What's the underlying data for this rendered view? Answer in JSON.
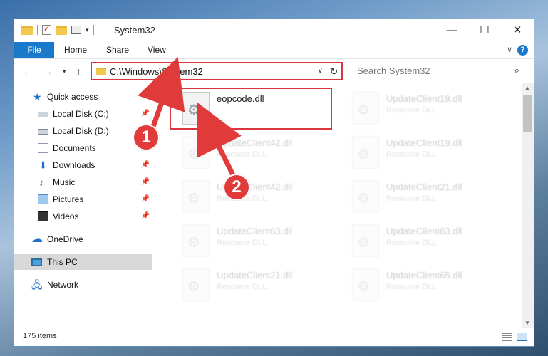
{
  "window": {
    "title": "System32",
    "minimize_glyph": "—",
    "maximize_glyph": "☐",
    "close_glyph": "✕"
  },
  "ribbon": {
    "tabs": [
      {
        "label": "File"
      },
      {
        "label": "Home"
      },
      {
        "label": "Share"
      },
      {
        "label": "View"
      }
    ],
    "help_glyph": "?"
  },
  "navigation": {
    "back_glyph": "←",
    "forward_glyph": "→",
    "recent_glyph": "▾",
    "up_glyph": "↑",
    "address": "C:\\Windows\\System32",
    "dropdown_glyph": "∨",
    "refresh_glyph": "↻",
    "search_placeholder": "Search System32",
    "search_glyph": "⌕"
  },
  "sidebar": {
    "items": [
      {
        "label": "Quick access",
        "icon": "star-icon",
        "pinned": false
      },
      {
        "label": "Local Disk (C:)",
        "icon": "drive-icon",
        "pinned": true
      },
      {
        "label": "Local Disk (D:)",
        "icon": "drive-icon",
        "pinned": false
      },
      {
        "label": "Documents",
        "icon": "documents-icon",
        "pinned": true
      },
      {
        "label": "Downloads",
        "icon": "download-icon",
        "pinned": true
      },
      {
        "label": "Music",
        "icon": "music-icon",
        "pinned": true
      },
      {
        "label": "Pictures",
        "icon": "pictures-icon",
        "pinned": true
      },
      {
        "label": "Videos",
        "icon": "videos-icon",
        "pinned": true
      },
      {
        "label": "OneDrive",
        "icon": "cloud-icon",
        "pinned": false
      },
      {
        "label": "This PC",
        "icon": "computer-icon",
        "pinned": false,
        "selected": true
      },
      {
        "label": "Network",
        "icon": "network-icon",
        "pinned": false
      }
    ],
    "pin_glyph": "📌"
  },
  "files": [
    {
      "name": "eopcode.dll",
      "type": "",
      "highlighted": true
    },
    {
      "name": "UpdateClient19.dll",
      "type": "Resource DLL"
    },
    {
      "name": "UpdateClient42.dll",
      "type": "Resource DLL"
    },
    {
      "name": "UpdateClient19.dll",
      "type": "Resource DLL"
    },
    {
      "name": "UpdateClient42.dll",
      "type": "Resource DLL"
    },
    {
      "name": "UpdateClient21.dll",
      "type": "Resource DLL"
    },
    {
      "name": "UpdateClient63.dll",
      "type": "Resource DLL"
    },
    {
      "name": "UpdateClient63.dll",
      "type": "Resource DLL"
    },
    {
      "name": "UpdateClient21.dll",
      "type": "Resource DLL"
    },
    {
      "name": "UpdateClient65.dll",
      "type": "Resource DLL"
    }
  ],
  "status": {
    "item_count": "175 items"
  },
  "annotations": [
    {
      "number": "1"
    },
    {
      "number": "2"
    }
  ],
  "colors": {
    "accent": "#1979ca",
    "highlight": "#d9363e",
    "marker": "#e03a3a"
  }
}
